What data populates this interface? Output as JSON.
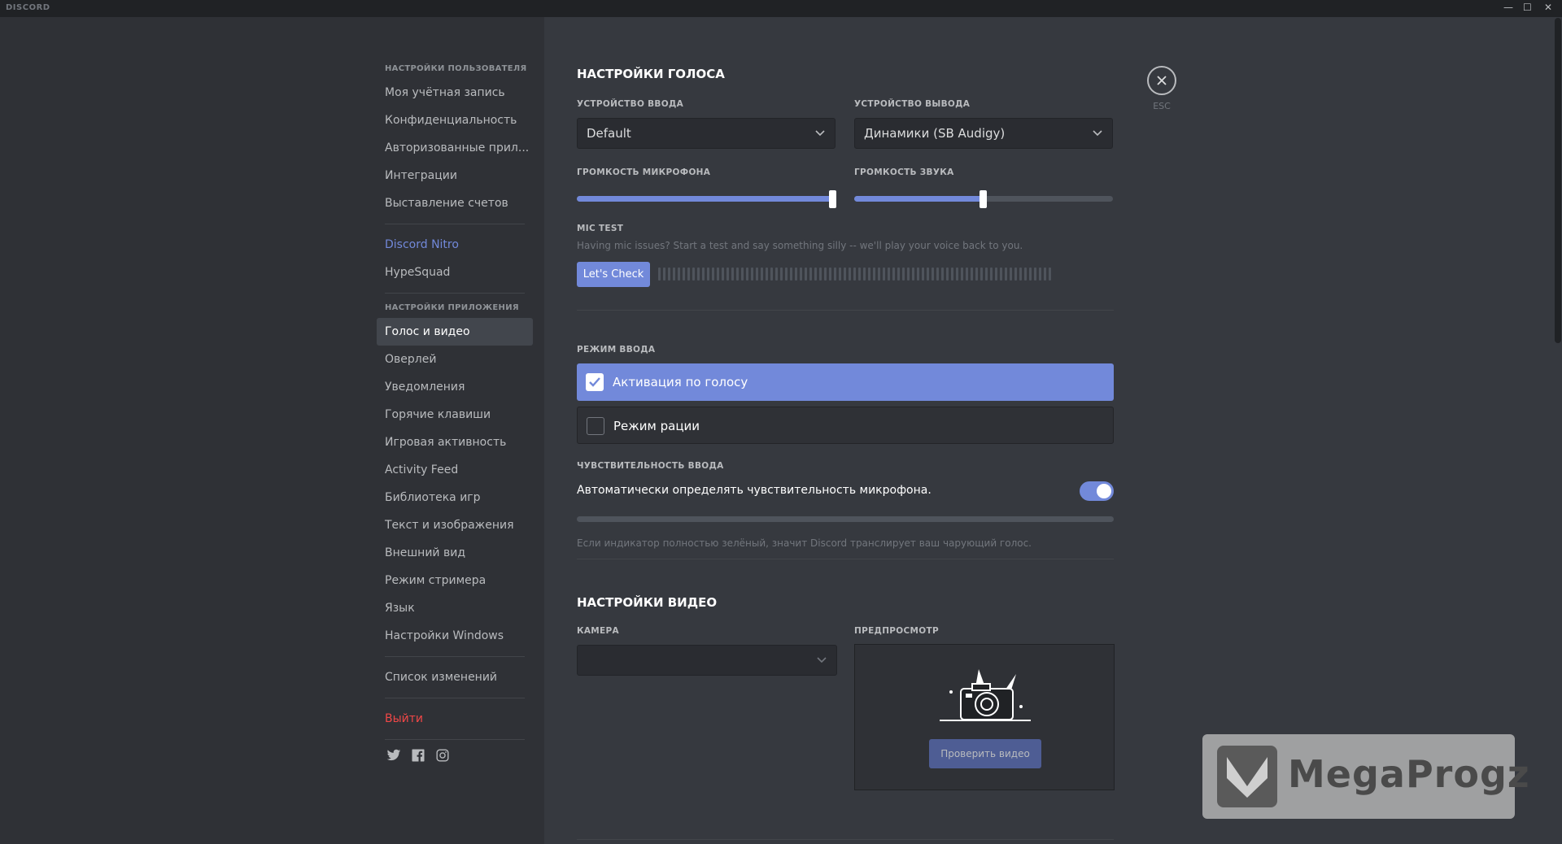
{
  "window": {
    "brand": "DISCORD",
    "minimize": "—",
    "maximize": "☐",
    "close": "✕"
  },
  "sidebar": {
    "user_header": "НАСТРОЙКИ ПОЛЬЗОВАТЕЛЯ",
    "user_items": [
      "Моя учётная запись",
      "Конфиденциальность",
      "Авторизованные прил...",
      "Интеграции",
      "Выставление счетов"
    ],
    "nitro": "Discord Nitro",
    "hypesquad": "HypeSquad",
    "app_header": "НАСТРОЙКИ ПРИЛОЖЕНИЯ",
    "app_items": [
      "Голос и видео",
      "Оверлей",
      "Уведомления",
      "Горячие клавиши",
      "Игровая активность",
      "Activity Feed",
      "Библиотека игр",
      "Текст и изображения",
      "Внешний вид",
      "Режим стримера",
      "Язык",
      "Настройки Windows"
    ],
    "selected_item": "Голос и видео",
    "changelog": "Список изменений",
    "logout": "Выйти",
    "social_icons": [
      "twitter-icon",
      "facebook-icon",
      "instagram-icon"
    ]
  },
  "voice": {
    "title": "НАСТРОЙКИ ГОЛОСА",
    "input_device_label": "УСТРОЙСТВО ВВОДА",
    "input_device_value": "Default",
    "output_device_label": "УСТРОЙСТВО ВЫВОДА",
    "output_device_value": "Динамики (SB Audigy)",
    "mic_volume_label": "ГРОМКОСТЬ МИКРОФОНА",
    "mic_volume_fraction": 0.99,
    "sound_volume_label": "ГРОМКОСТЬ ЗВУКА",
    "sound_volume_fraction": 0.5,
    "mic_test_label": "MIC TEST",
    "mic_test_hint": "Having mic issues? Start a test and say something silly -- we'll play your voice back to you.",
    "mic_test_button": "Let's Check",
    "input_mode_label": "РЕЖИМ ВВОДА",
    "mode_voice": "Активация по голосу",
    "mode_ptt": "Режим рации",
    "selected_mode": "Активация по голосу",
    "sensitivity_label": "ЧУВСТВИТЕЛЬНОСТЬ ВВОДА",
    "auto_sensitivity": "Автоматически определять чувствительность микрофона.",
    "auto_sensitivity_on": true,
    "sensitivity_hint": "Если индикатор полностью зелёный, значит Discord транслирует ваш чарующий голос."
  },
  "video": {
    "title": "НАСТРОЙКИ ВИДЕО",
    "camera_label": "КАМЕРА",
    "camera_value": "",
    "preview_label": "ПРЕДПРОСМОТР",
    "test_video_button": "Проверить видео"
  },
  "close_label": "ESC",
  "watermark": "MegaProgz",
  "colors": {
    "accent": "#7289da",
    "danger": "#f04747",
    "bg": "#36393f",
    "sidebar": "#2f3136"
  }
}
